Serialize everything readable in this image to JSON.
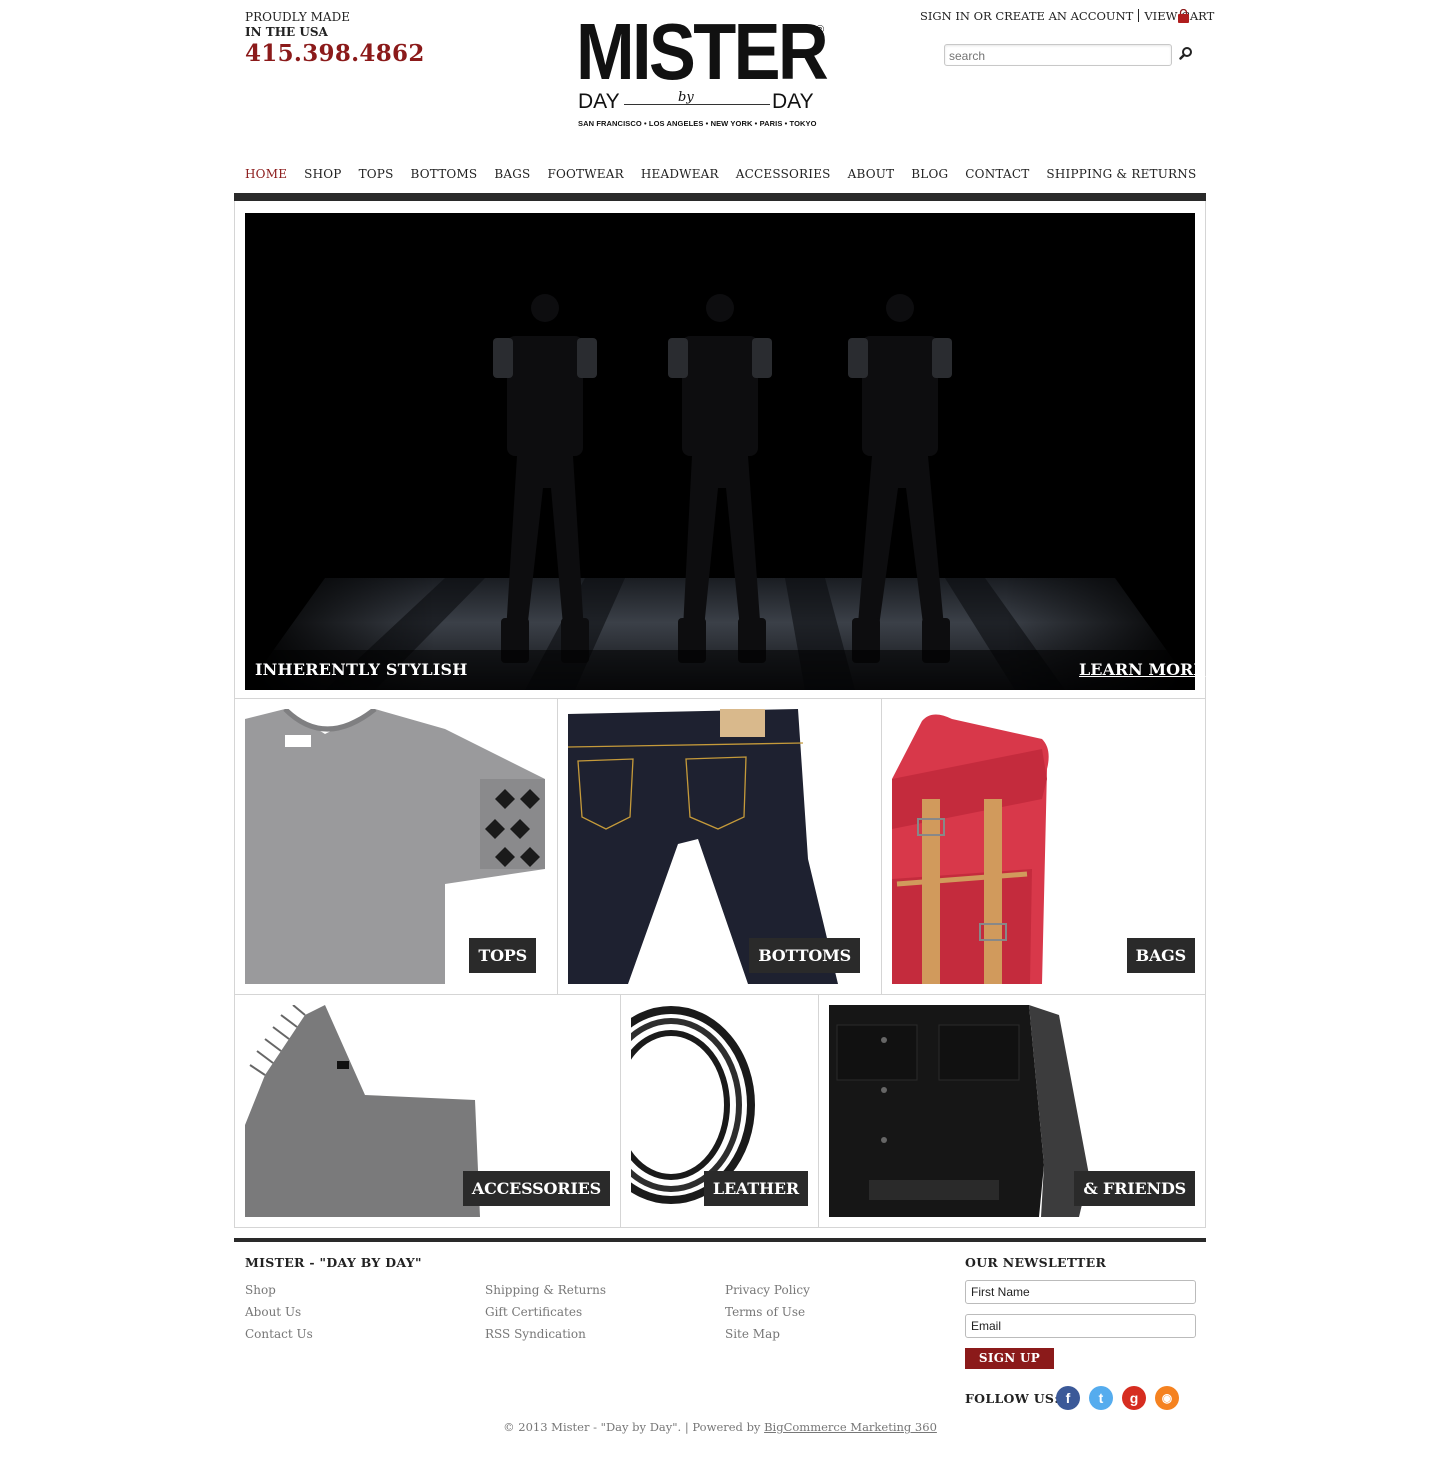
{
  "header": {
    "tagline_line1": "PROUDLY MADE",
    "tagline_line2": "IN THE USA",
    "phone": "415.398.4862",
    "logo": {
      "word": "MISTER",
      "registered": "®",
      "day_left": "DAY",
      "by": "by",
      "day_right": "DAY",
      "cities": "SAN FRANCISCO • LOS ANGELES • NEW YORK • PARIS • TOKYO"
    },
    "account_link": "SIGN IN OR CREATE AN ACCOUNT",
    "cart_link": "VIEW CART",
    "search_placeholder": "search"
  },
  "nav": {
    "items": [
      {
        "label": "HOME",
        "active": true
      },
      {
        "label": "SHOP"
      },
      {
        "label": "TOPS"
      },
      {
        "label": "BOTTOMS"
      },
      {
        "label": "BAGS"
      },
      {
        "label": "FOOTWEAR"
      },
      {
        "label": "HEADWEAR"
      },
      {
        "label": "ACCESSORIES"
      },
      {
        "label": "ABOUT"
      },
      {
        "label": "BLOG"
      },
      {
        "label": "CONTACT"
      },
      {
        "label": "SHIPPING & RETURNS"
      }
    ]
  },
  "hero": {
    "caption": "INHERENTLY STYLISH",
    "cta": "LEARN MORE"
  },
  "tiles": {
    "tops": "TOPS",
    "bottoms": "BOTTOMS",
    "bags": "BAGS",
    "accessories": "ACCESSORIES",
    "leather": "LEATHER",
    "friends": "& FRIENDS"
  },
  "footer": {
    "title": "MISTER - \"DAY BY DAY\"",
    "col1": [
      "Shop",
      "About Us",
      "Contact Us"
    ],
    "col2": [
      "Shipping & Returns",
      "Gift Certificates",
      "RSS Syndication"
    ],
    "col3": [
      "Privacy Policy",
      "Terms of Use",
      "Site Map"
    ],
    "newsletter_title": "OUR NEWSLETTER",
    "first_name_value": "First Name",
    "email_value": "Email",
    "signup_label": "SIGN UP",
    "follow_label": "FOLLOW US:",
    "social": [
      "facebook-icon",
      "twitter-icon",
      "google-plus-icon",
      "rss-icon"
    ],
    "copyright_text": "© 2013 Mister - \"Day by Day\". | Powered by ",
    "copyright_link": "BigCommerce Marketing 360"
  },
  "colors": {
    "brand_red": "#8b1a1a",
    "dark_bar": "#2a2a2a"
  }
}
